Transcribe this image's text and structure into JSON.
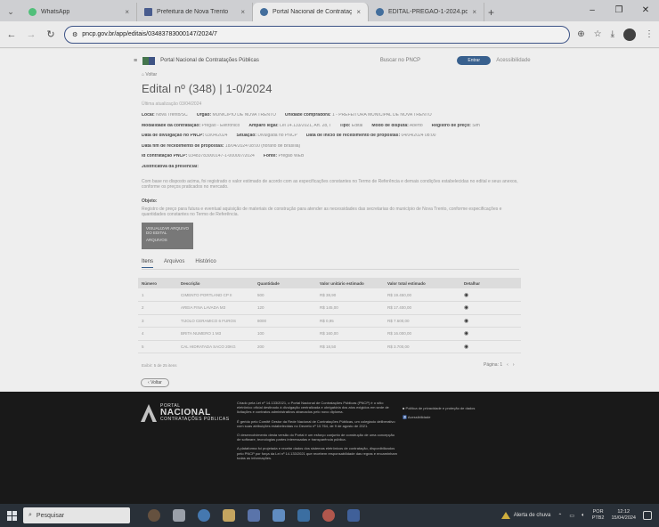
{
  "browser": {
    "tabs": [
      {
        "title": "WhatsApp",
        "favicon_color": "#25d366",
        "active": false
      },
      {
        "title": "Prefeitura de Nova Trento",
        "favicon_color": "#3a58a8",
        "active": false
      },
      {
        "title": "Portal Nacional de Contratação",
        "favicon_color": "#2b6fb8",
        "active": true
      },
      {
        "title": "EDITAL-PREGAO-1-2024.pdf",
        "favicon_color": "#2b6fb8",
        "active": false
      }
    ],
    "new_tab_label": "+",
    "url": "pncp.gov.br/app/editais/03483783000147/2024/7"
  },
  "site": {
    "name": "Portal Nacional de Contratações Públicas",
    "search_label": "Buscar no PNCP",
    "pill_label": "Entrar",
    "links": [
      "Acessibilidade"
    ]
  },
  "breadcrumb": "Voltar",
  "page_title": "Edital nº (348) | 1-0/2024",
  "subline": "Última atualização 03/04/2024",
  "fields": [
    [
      {
        "k": "Local:",
        "v": "Nova Trento/SC"
      },
      {
        "k": "Órgão:",
        "v": "MUNICIPIO DE NOVA TRENTO"
      },
      {
        "k": "Unidade compradora:",
        "v": "1 - PREFEITURA MUNICIPAL DE NOVA TRENTO"
      }
    ],
    [
      {
        "k": "Modalidade da contratação:",
        "v": "Pregão - Eletrônico"
      },
      {
        "k": "Amparo legal:",
        "v": "Lei 14.133/2021, Art. 28, I"
      },
      {
        "k": "Tipo:",
        "v": "Edital"
      },
      {
        "k": "Modo de disputa:",
        "v": "Aberto"
      },
      {
        "k": "Registro de preço:",
        "v": "Sim"
      }
    ],
    [
      {
        "k": "Data de divulgação no PNCP:",
        "v": "03/04/2024"
      },
      {
        "k": "Situação:",
        "v": "Divulgada no PNCP"
      },
      {
        "k": "Data de início de recebimento de propostas:",
        "v": "04/04/2024 08:00"
      }
    ],
    [
      {
        "k": "Data fim de recebimento de propostas:",
        "v": "18/04/2024 08:00 (horário de Brasília)"
      }
    ],
    [
      {
        "k": "Id contratação PNCP:",
        "v": "03483783000147-1-000007/2024"
      },
      {
        "k": "Fonte:",
        "v": "Pregão WEB"
      }
    ],
    [
      {
        "k": "Justificativa da presencial:",
        "v": ""
      }
    ]
  ],
  "sections": {
    "justification_text": "Com base no disposto acima, foi registrado o valor estimado de acordo com as especificações constantes no Termo de Referência e demais condições estabelecidas no edital e seus anexos, conforme os preços praticados no mercado.",
    "objeto_label": "Objeto:",
    "objeto_text": "Registro de preço para futura e eventual aquisição de materiais de construção para atender as necessidades das secretarias do município de Nova Trento, conforme especificações e quantidades constantes no Termo de Referência."
  },
  "thumb": {
    "line1": "VISUALIZAR ARQUIVO",
    "line2": "DO EDITAL",
    "line3": "ARQUIVOS"
  },
  "content_tabs": [
    "Itens",
    "Arquivos",
    "Histórico"
  ],
  "table": {
    "headers": [
      "Número",
      "Descrição",
      "Quantidade",
      "Valor unitário estimado",
      "Valor total estimado",
      "Detalhar"
    ],
    "rows": [
      [
        "1",
        "CIMENTO PORTLAND CP II",
        "500",
        "R$ 38,90",
        "R$ 19.450,00"
      ],
      [
        "2",
        "AREIA FINA LAVADA M3",
        "120",
        "R$ 145,00",
        "R$ 17.400,00"
      ],
      [
        "3",
        "TIJOLO CERAMICO 6 FUROS",
        "8000",
        "R$ 0,95",
        "R$ 7.600,00"
      ],
      [
        "4",
        "BRITA NUMERO 1 M3",
        "100",
        "R$ 160,00",
        "R$ 16.000,00"
      ],
      [
        "5",
        "CAL HIDRATADA SACO 20KG",
        "200",
        "R$ 18,50",
        "R$ 3.700,00"
      ]
    ]
  },
  "pager": {
    "left": "Exibir: 5 de 25 itens",
    "right": "Página: 1",
    "prev": "‹",
    "next": "›"
  },
  "back_button": "Voltar",
  "footer": {
    "logo_l1": "PORTAL",
    "logo_l2": "NACIONAL",
    "logo_l3": "CONTRATAÇÕES PÚBLICAS",
    "paragraphs": [
      "Criado pela Lei nº 14.133/2021, o Portal Nacional de Contratações Públicas (PNCP) é o sítio eletrônico oficial destinado à divulgação centralizada e obrigatória dos atos exigidos em sede de licitações e contratos administrativos abarcados pelo novo diploma.",
      "É gerido pelo Comitê Gestor da Rede Nacional de Contratações Públicas, um colegiado deliberativo com suas atribuições estabelecidas no Decreto nº 10.764, de 9 de agosto de 2021.",
      "O desenvolvimento desta versão do Portal é um esforço conjunto de construção de uma concepção de software, tecnologias partes interessadas e transparência pública.",
      "A plataforma foi projetada e recebe dados dos sistemas eletrônicos de contratação, disponibilizados pelo PNCP por força da Lei nº 14.133/2021 que recebem responsabilidade das regras e encaminham todas as informações."
    ],
    "links": [
      "Política de privacidade e proteção de dados",
      "Acessibilidade"
    ]
  },
  "taskbar": {
    "search_label": "Pesquisar",
    "weather": "Alerta de chuva",
    "lang_l1": "POR",
    "lang_l2": "PTB2",
    "time": "12:12",
    "date": "15/04/2024"
  }
}
